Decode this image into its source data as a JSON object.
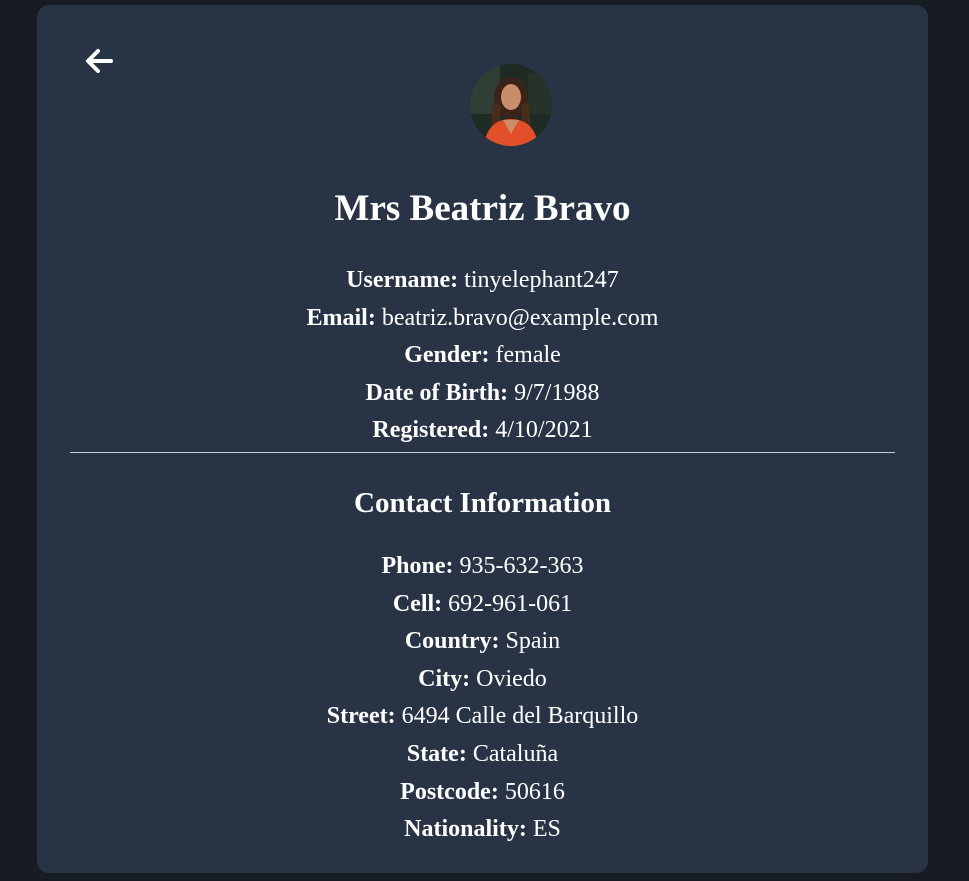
{
  "profile": {
    "name": "Mrs Beatriz Bravo",
    "avatar_icon": "user-photo",
    "basic": {
      "username_label": "Username:",
      "username": "tinyelephant247",
      "email_label": "Email:",
      "email": "beatriz.bravo@example.com",
      "gender_label": "Gender:",
      "gender": "female",
      "dob_label": "Date of Birth:",
      "dob": "9/7/1988",
      "registered_label": "Registered:",
      "registered": "4/10/2021"
    },
    "contact_title": "Contact Information",
    "contact": {
      "phone_label": "Phone:",
      "phone": "935-632-363",
      "cell_label": "Cell:",
      "cell": "692-961-061",
      "country_label": "Country:",
      "country": "Spain",
      "city_label": "City:",
      "city": "Oviedo",
      "street_label": "Street:",
      "street": "6494 Calle del Barquillo",
      "state_label": "State:",
      "state": "Cataluña",
      "postcode_label": "Postcode:",
      "postcode": "50616",
      "nationality_label": "Nationality:",
      "nationality": "ES"
    }
  },
  "nav": {
    "back_icon": "arrow-left-icon"
  },
  "colors": {
    "page_bg": "#171b24",
    "card_bg": "#283446",
    "text": "#ffffff",
    "divider": "#c8ccd2"
  }
}
